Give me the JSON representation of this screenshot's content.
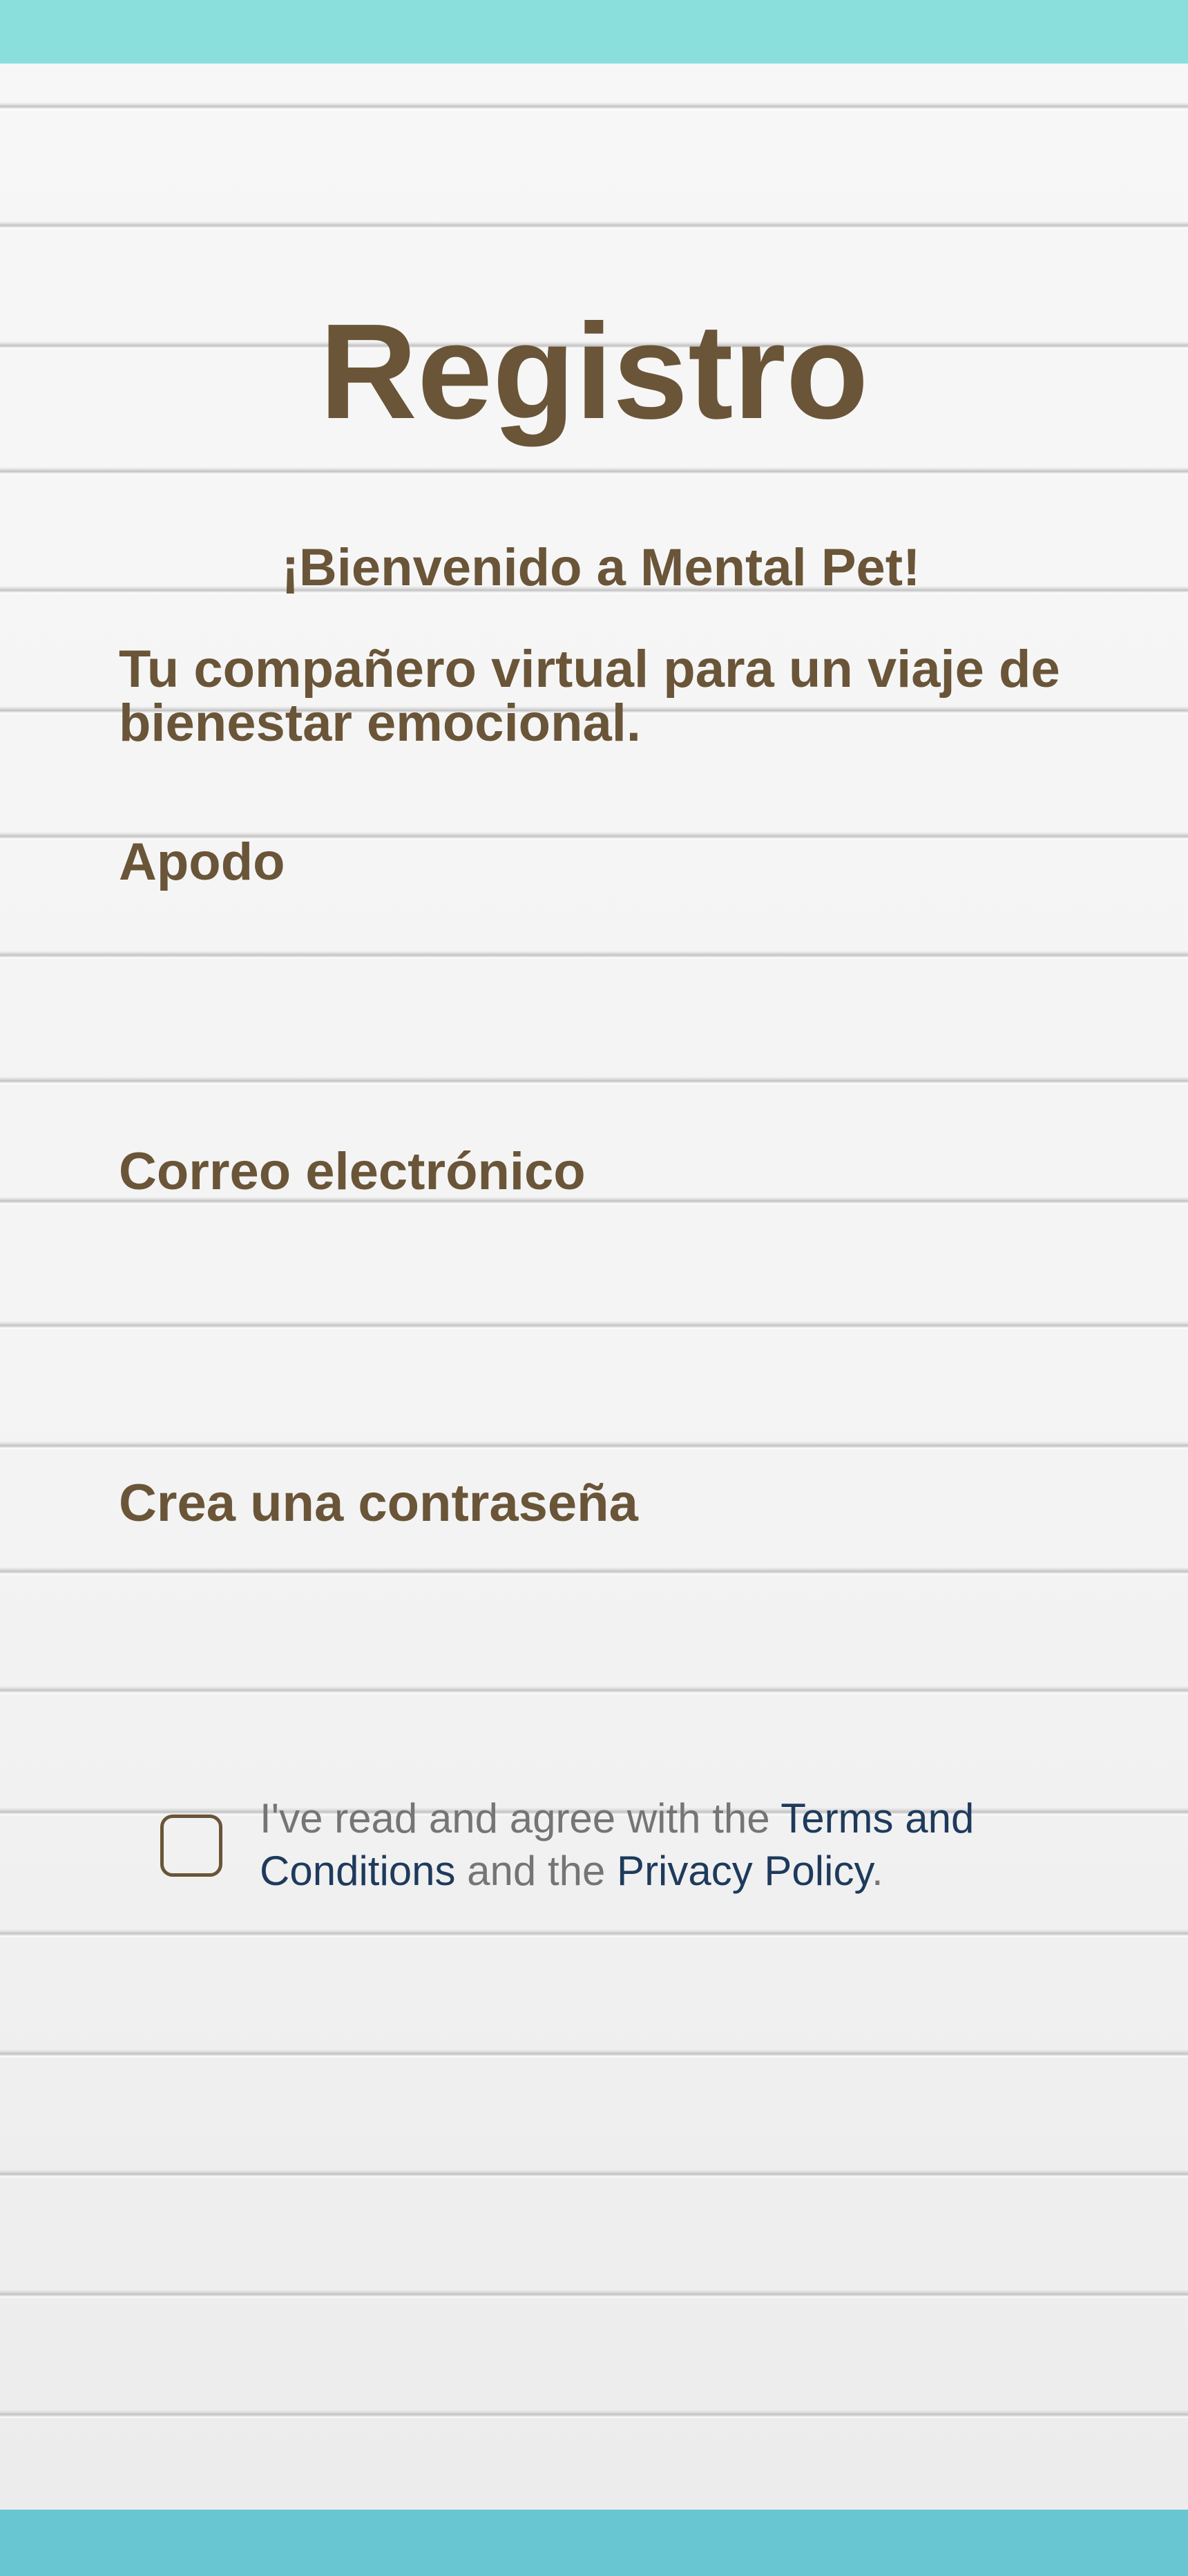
{
  "header": {
    "title": "Registro",
    "welcome": "¡Bienvenido a Mental Pet!",
    "tagline": "Tu compañero virtual para un viaje de bienestar emocional."
  },
  "form": {
    "nickname_label": "Apodo",
    "nickname_value": "",
    "email_label": "Correo electrónico",
    "email_value": "",
    "password_label": "Crea una contraseña",
    "password_value": ""
  },
  "agreement": {
    "checked": false,
    "text_before": "I've read and agree with the ",
    "terms_link": "Terms and Conditions",
    "text_middle": " and the ",
    "privacy_link": "Privacy Policy",
    "text_after": "."
  },
  "colors": {
    "top_bar": "#8adfdd",
    "bottom_bar": "#67c6d1",
    "text_brown": "#6a5538",
    "link_navy": "#1e3a5c",
    "muted_gray": "#757575"
  }
}
